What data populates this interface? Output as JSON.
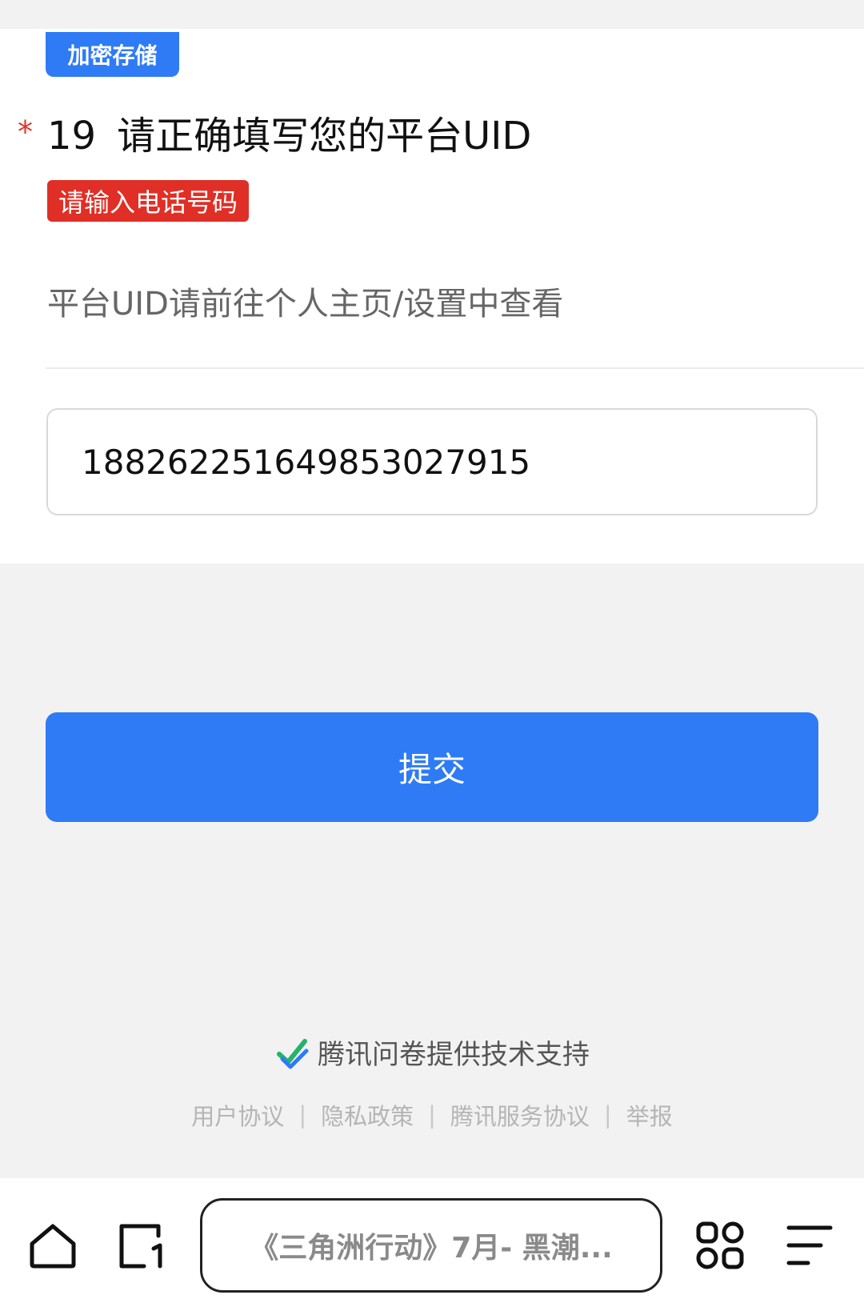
{
  "form": {
    "encrypted_badge": "加密存储",
    "required_mark": "*",
    "question_number": "19",
    "question_title": "请正确填写您的平台UID",
    "error_badge": "请输入电话号码",
    "hint": "平台UID请前往个人主页/设置中查看",
    "uid_value": "1882622516498530​27915",
    "submit_label": "提交"
  },
  "footer": {
    "support_text": "腾讯问卷提供技术支持",
    "links": [
      "用户协议",
      "隐私政策",
      "腾讯服务协议",
      "举报"
    ],
    "separator": "|"
  },
  "browser": {
    "address_text": "《三角洲行动》7月- 黑潮...",
    "icons": [
      "home-icon",
      "tab-icon",
      "apps-icon",
      "menu-icon"
    ]
  },
  "colors": {
    "accent": "#2f7bf6",
    "error": "#e02f26"
  }
}
